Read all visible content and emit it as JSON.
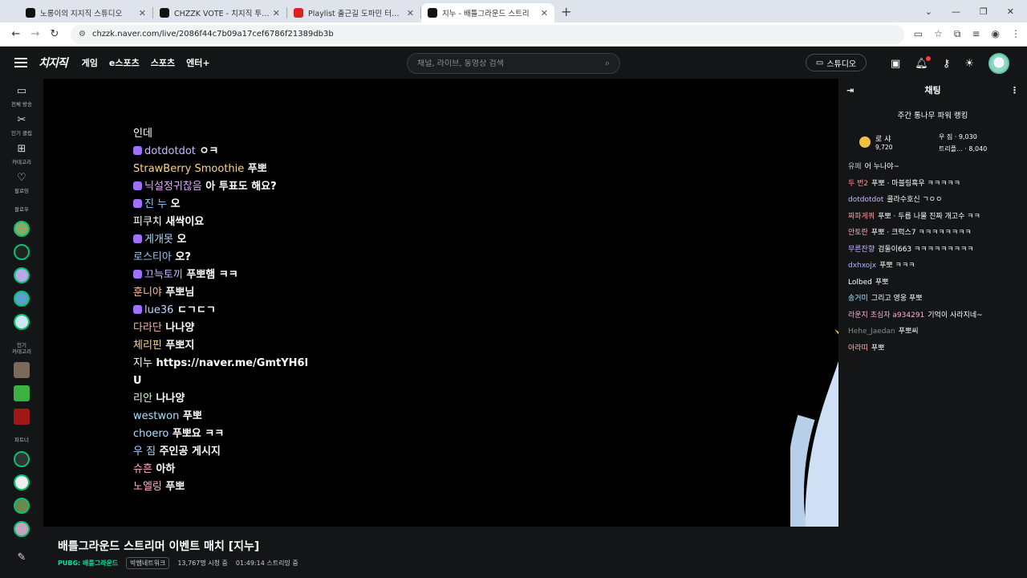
{
  "browser": {
    "tabs": [
      {
        "title": "노롱이의 지지직 스튜디오",
        "favicon_color": "#111111",
        "active": false
      },
      {
        "title": "CHZZK VOTE - 치지직 투표 주",
        "favicon_color": "#111111",
        "active": false
      },
      {
        "title": "Playlist 출근길 도파민 터지는",
        "favicon_color": "#e02020",
        "active": false
      },
      {
        "title": "지누 - 배틀그라운드 스트리",
        "favicon_color": "#111111",
        "active": true
      }
    ],
    "url": "chzzk.naver.com/live/2086f44c7b09a17cef6786f21389db3b"
  },
  "header": {
    "logo": "치지직",
    "nav": [
      "게임",
      "e스포츠",
      "스포츠",
      "엔터+"
    ],
    "search_placeholder": "채널, 라이브, 동영상 검색",
    "studio_label": "스튜디오"
  },
  "sidebar": {
    "top": [
      {
        "icon": "tv-icon",
        "label": "전체 방송"
      },
      {
        "icon": "scissors-icon",
        "label": "인기 클립"
      },
      {
        "icon": "grid-icon",
        "label": "카테고리"
      },
      {
        "icon": "heart-icon",
        "label": "팔로잉"
      }
    ],
    "following_label": "팔로우",
    "category_label_1": "인기",
    "category_label_2": "카테고리",
    "partner_label": "파트너"
  },
  "overlay_chat": [
    {
      "nick": "인데",
      "text": "",
      "nick_color": "#ffffff",
      "badge": false
    },
    {
      "nick": "dotdotdot",
      "text": "ㅇㅋ",
      "nick_color": "#c9b8ff",
      "badge": true
    },
    {
      "nick": "StrawBerry Smoothie",
      "text": "푸뽀",
      "nick_color": "#ffd580",
      "badge": false
    },
    {
      "nick": "닉설정귀찮음",
      "text": "아 투표도 해요?",
      "nick_color": "#e0a8ff",
      "badge": true
    },
    {
      "nick": "진 누",
      "text": "오",
      "nick_color": "#8fc9ff",
      "badge": true
    },
    {
      "nick": "피쿠치",
      "text": "새싹이요",
      "nick_color": "#ffffff",
      "badge": false
    },
    {
      "nick": "게개못",
      "text": "오",
      "nick_color": "#a8d8ff",
      "badge": true
    },
    {
      "nick": "로스티아",
      "text": "오?",
      "nick_color": "#8fc9ff",
      "badge": false
    },
    {
      "nick": "끄늑토끼",
      "text": "푸뽀햄 ㅋㅋ",
      "nick_color": "#c9b8ff",
      "badge": true
    },
    {
      "nick": "훈니야",
      "text": "푸뽀님",
      "nick_color": "#ffc0a0",
      "badge": false
    },
    {
      "nick": "lue36",
      "text": "ㄷㄱㄷㄱ",
      "nick_color": "#b8d0ff",
      "badge": true
    },
    {
      "nick": "다라단",
      "text": "나나양",
      "nick_color": "#ffb0b0",
      "badge": false
    },
    {
      "nick": "체리핀",
      "text": "푸뽀지",
      "nick_color": "#ffd580",
      "badge": false
    },
    {
      "nick": "지누",
      "text": "https://naver.me/GmtYH6l",
      "nick_color": "#ffffff",
      "badge": false
    },
    {
      "nick": "",
      "text": "U",
      "nick_color": "#ffffff",
      "badge": false
    },
    {
      "nick": "리안",
      "text": "나나양",
      "nick_color": "#d0ffd0",
      "badge": false
    },
    {
      "nick": "westwon",
      "text": "푸뽀",
      "nick_color": "#a8e0ff",
      "badge": false
    },
    {
      "nick": "choero",
      "text": "푸뽀요 ㅋㅋ",
      "nick_color": "#a8e0ff",
      "badge": false
    },
    {
      "nick": "우 짐",
      "text": "주인공 게시지",
      "nick_color": "#a8d8ff",
      "badge": false
    },
    {
      "nick": "슈흔",
      "text": "아하",
      "nick_color": "#ffb0d0",
      "badge": false
    },
    {
      "nick": "노엘링",
      "text": "푸뽀",
      "nick_color": "#ffb0d0",
      "badge": false
    }
  ],
  "stream": {
    "title": "배틀그라운드 스트리머 이벤트 매치 [지누]",
    "category": "PUBG: 배틀그라운드",
    "tag": "박쌤네트워크",
    "viewers": "13,767명 시청 중",
    "uptime": "01:49:14 스트리밍 중"
  },
  "chat": {
    "title": "채팅",
    "ranking_title": "주간 통나무 파워 랭킹",
    "rank1": {
      "name": "로 샤",
      "score": "9,720"
    },
    "rank2": {
      "name": "우 짐",
      "score": "9,030"
    },
    "rank3": {
      "name": "트리플...",
      "score": "8,040"
    },
    "messages": [
      {
        "nick": "유페",
        "text": "어 누나야~",
        "color": "#bbbbbb"
      },
      {
        "nick": "두 번2",
        "text": "푸뽀 · 마블링흑우 ㅋㅋㅋㅋㅋ",
        "color": "#ff9a9a"
      },
      {
        "nick": "dotdotdot",
        "text": "콜라수호신 ㄱㅇㅇ",
        "color": "#c9b8ff"
      },
      {
        "nick": "짜파게쿼",
        "text": "푸뽀 · 두릅 나물 진짜 개고수 ㅋㅋ",
        "color": "#ff9a9a"
      },
      {
        "nick": "안토란",
        "text": "푸뽀 · 크럭스7 ㅋㅋㅋㅋㅋㅋㅋㅋ",
        "color": "#ffb0b0"
      },
      {
        "nick": "무른잔향",
        "text": "검둘이663 ㅋㅋㅋㅋㅋㅋㅋㅋㅋ",
        "color": "#c9b8ff"
      },
      {
        "nick": "dxhxojx",
        "text": "푸뽀 ㅋㅋㅋ",
        "color": "#a8b8ff"
      },
      {
        "nick": "Lolbed",
        "text": "푸뽀",
        "color": "#ffffff"
      },
      {
        "nick": "송거미",
        "text": "그리고 영웅 푸뽀",
        "color": "#a8e0ff"
      },
      {
        "nick": "라운지 초심자 a934291",
        "text": "기억이 사라지네~",
        "color": "#ffb0d0"
      },
      {
        "nick": "Hehe_Jaedan",
        "text": "푸뽀씨",
        "color": "#888888"
      },
      {
        "nick": "아라띠",
        "text": "푸뽀",
        "color": "#ffb0b0"
      }
    ]
  }
}
